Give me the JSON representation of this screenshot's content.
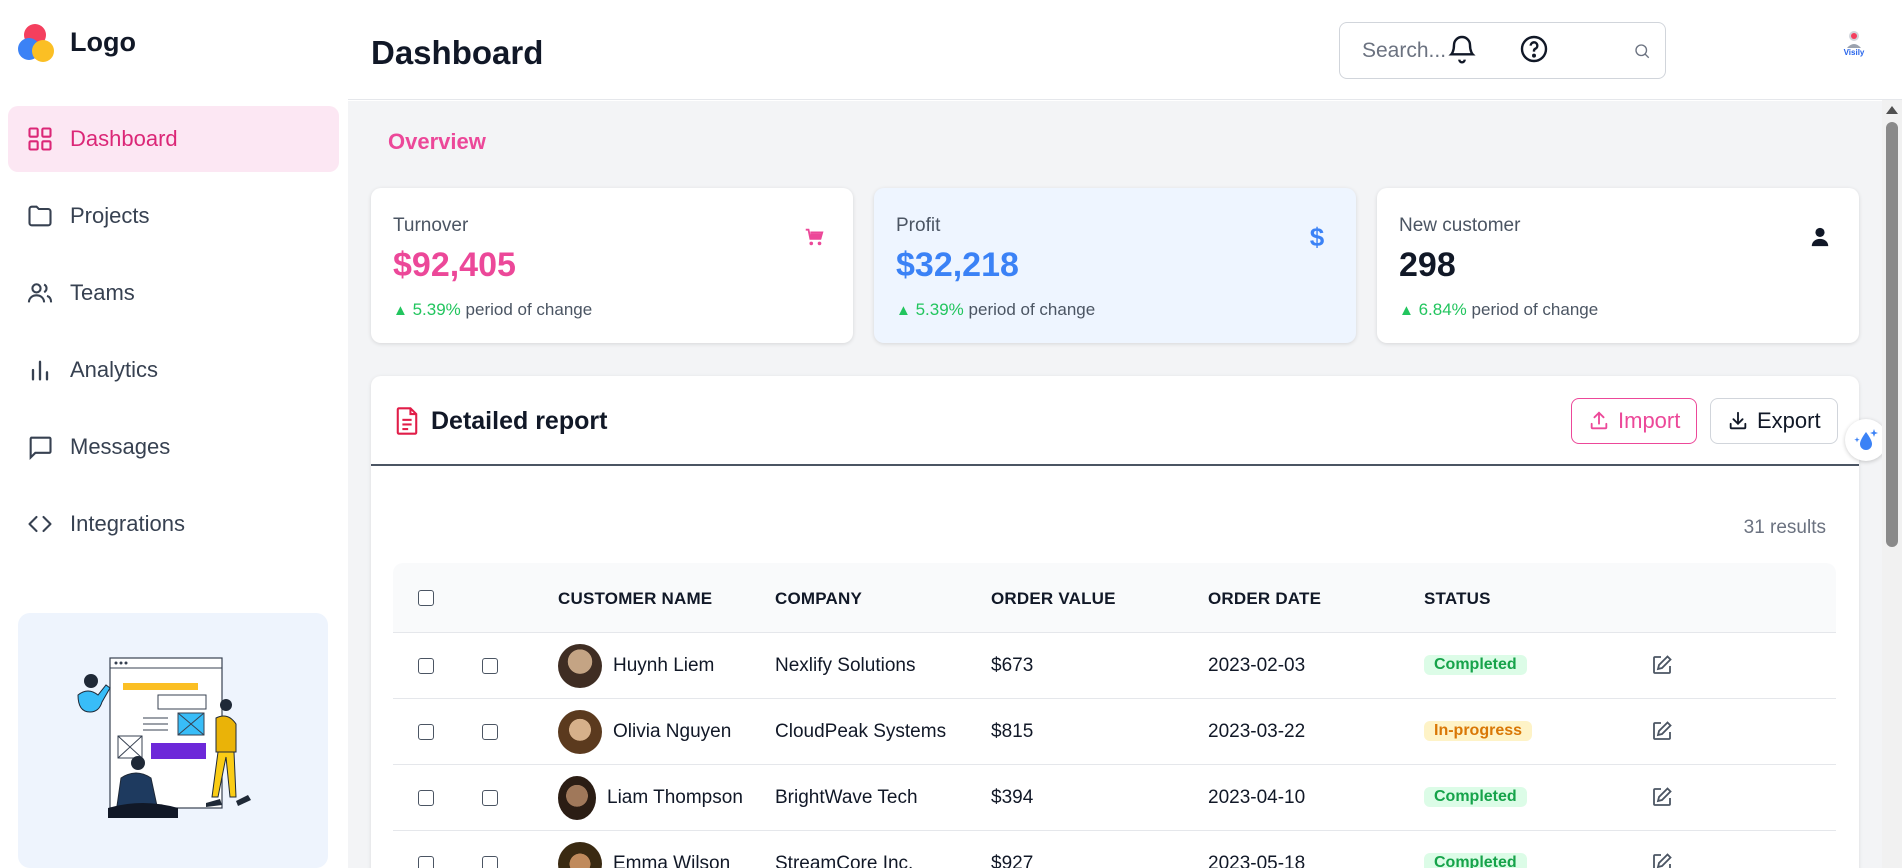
{
  "brand": {
    "logo_text": "Logo"
  },
  "sidebar": {
    "items": [
      {
        "label": "Dashboard",
        "icon": "grid-icon",
        "active": true
      },
      {
        "label": "Projects",
        "icon": "folder-icon",
        "active": false
      },
      {
        "label": "Teams",
        "icon": "users-icon",
        "active": false
      },
      {
        "label": "Analytics",
        "icon": "bar-chart-icon",
        "active": false
      },
      {
        "label": "Messages",
        "icon": "message-icon",
        "active": false
      },
      {
        "label": "Integrations",
        "icon": "code-icon",
        "active": false
      }
    ]
  },
  "header": {
    "title": "Dashboard",
    "search_placeholder": "Search...",
    "avatar_text": "Visily"
  },
  "overview": {
    "title": "Overview",
    "cards": [
      {
        "label": "Turnover",
        "value": "$92,405",
        "change": "5.39%",
        "change_text": "period of change",
        "icon": "cart-icon",
        "accent": "#ec4899"
      },
      {
        "label": "Profit",
        "value": "$32,218",
        "change": "5.39%",
        "change_text": "period of change",
        "icon": "dollar-icon",
        "accent": "#3b82f6"
      },
      {
        "label": "New customer",
        "value": "298",
        "change": "6.84%",
        "change_text": "period of change",
        "icon": "user-icon",
        "accent": "#111827"
      }
    ]
  },
  "report": {
    "title": "Detailed report",
    "import_label": "Import",
    "export_label": "Export",
    "results": "31 results",
    "columns": [
      "CUSTOMER NAME",
      "COMPANY",
      "ORDER VALUE",
      "ORDER DATE",
      "STATUS"
    ],
    "rows": [
      {
        "name": "Huynh Liem",
        "company": "Nexlify Solutions",
        "value": "$673",
        "date": "2023-02-03",
        "status": "Completed"
      },
      {
        "name": "Olivia Nguyen",
        "company": "CloudPeak Systems",
        "value": "$815",
        "date": "2023-03-22",
        "status": "In-progress"
      },
      {
        "name": "Liam Thompson",
        "company": "BrightWave Tech",
        "value": "$394",
        "date": "2023-04-10",
        "status": "Completed"
      },
      {
        "name": "Emma Wilson",
        "company": "StreamCore Inc.",
        "value": "$927",
        "date": "2023-05-18",
        "status": "Completed"
      }
    ]
  },
  "colors": {
    "brand_pink": "#ec4899",
    "brand_blue": "#3b82f6",
    "positive_green": "#22c55e"
  }
}
